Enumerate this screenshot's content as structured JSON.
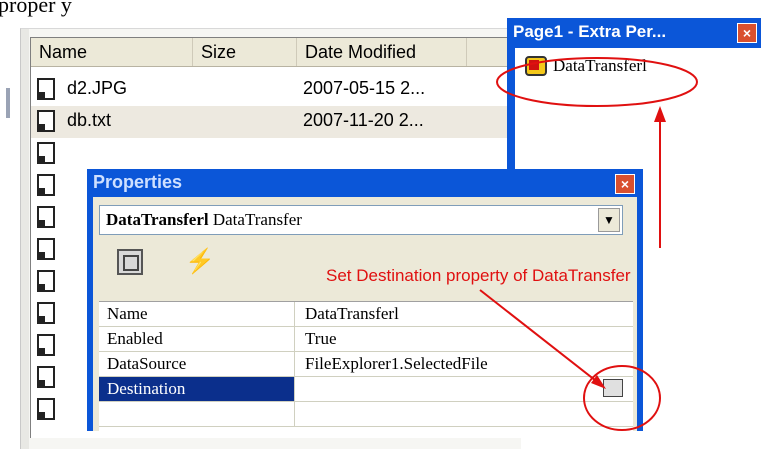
{
  "top_text": "proper y",
  "file_list": {
    "columns": [
      "Name",
      "Size",
      "Date Modified"
    ],
    "rows": [
      {
        "name": "d2.JPG",
        "date": "2007-05-15 2..."
      },
      {
        "name": "db.txt",
        "date": "2007-11-20 2..."
      }
    ]
  },
  "extra_window": {
    "title": "Page1 - Extra Per...",
    "close": "×",
    "component_label": "DataTransferl"
  },
  "properties": {
    "title": "Properties",
    "close": "×",
    "selector_name": "DataTransferl",
    "selector_type": " DataTransfer",
    "grid": [
      {
        "name": "Name",
        "value": "DataTransferl"
      },
      {
        "name": "Enabled",
        "value": "True"
      },
      {
        "name": "DataSource",
        "value": "FileExplorer1.SelectedFile"
      },
      {
        "name": "Destination",
        "value": ""
      }
    ]
  },
  "annotation": {
    "text": "Set Destination property of DataTransfer",
    "color": "#e01010"
  },
  "colors": {
    "titlebar": "#0b56d8",
    "selected_row": "#0b2f8c",
    "window_bg": "#ece9d8"
  }
}
